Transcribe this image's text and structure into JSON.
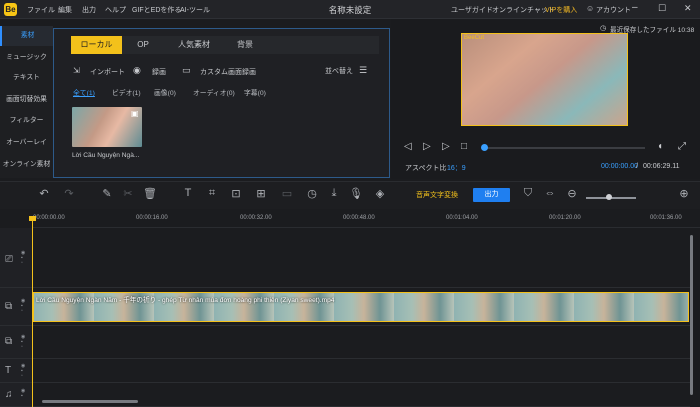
{
  "app": {
    "logo": "Be",
    "title": "名称未設定",
    "menu": [
      "ファイル",
      "編集",
      "出力",
      "ヘルプ",
      "GIFとEDを作る",
      "AI-ツール"
    ],
    "top_right": {
      "user_guide": "ユーザガイド",
      "online_chat": "オンラインチャット",
      "vip": "VIPを購入",
      "account": "アカウント"
    },
    "window_controls": [
      "minimize-icon",
      "maximize-icon",
      "close-icon"
    ]
  },
  "sidebar": {
    "items": [
      {
        "label": "素材"
      },
      {
        "label": "ミュージック"
      },
      {
        "label": "テキスト"
      },
      {
        "label": "画面切替効果"
      },
      {
        "label": "フィルター"
      },
      {
        "label": "オーバーレイ"
      },
      {
        "label": "オンライン素材"
      }
    ]
  },
  "media": {
    "tabs": [
      {
        "label": "ローカル"
      },
      {
        "label": "OP"
      },
      {
        "label": "人気素材"
      },
      {
        "label": "背景"
      }
    ],
    "toolbar": {
      "import": "インポート",
      "record": "録画",
      "custom_record": "カスタム画面録画",
      "sort": "並べ替え"
    },
    "filters": [
      {
        "label": "全て(1)"
      },
      {
        "label": "ビデオ(1)"
      },
      {
        "label": "画像(0)"
      },
      {
        "label": "オーディオ(0)"
      },
      {
        "label": "字幕(0)"
      }
    ],
    "items": [
      {
        "name": "Lời Cầu Nguyện Ngà..."
      }
    ]
  },
  "preview": {
    "watermark": "BeeCut",
    "saved": "最近保存したファイル 10:38",
    "aspect_label": "アスペクト比",
    "aspect_value": "16：9",
    "time_current": "00:00:00.00",
    "time_separator": "/",
    "time_total": "00:06:29.11",
    "progress": 0.0
  },
  "toolbar": {
    "speech_to_text": "音声文字変換",
    "export": "出力",
    "zoom": 0.45
  },
  "timeline": {
    "ticks": [
      "00:00:00.00",
      "00:00:16.00",
      "00:00:32.00",
      "00:00:48.00",
      "00:01:04.00",
      "00:01:20.00",
      "00:01:36.00"
    ],
    "clip_label": "Lời Cầu Nguyện Ngàn Năm - 千年の祈り - ghép Từ nhân mùa đơn hoàng phi thiên (Ziyan sweet).mp4",
    "tracks": [
      "video-track-icon",
      "main-track-icon",
      "pip-track-icon",
      "text-track-icon",
      "audio-track-icon"
    ]
  }
}
